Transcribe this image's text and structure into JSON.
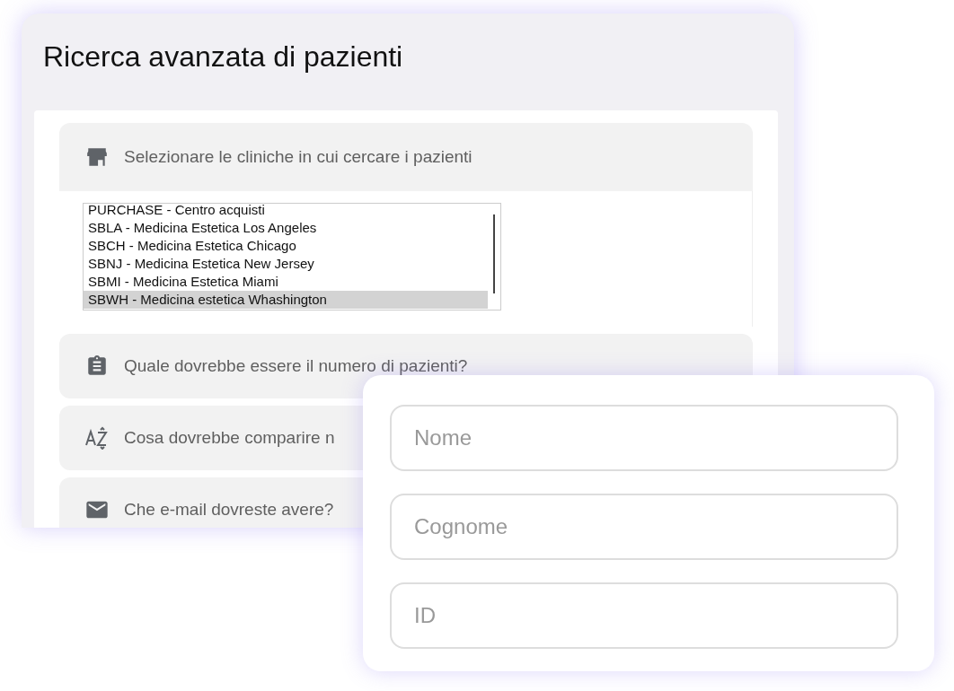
{
  "window": {
    "title": "Ricerca avanzata di pazienti"
  },
  "sections": [
    {
      "label": "Selezionare le cliniche in cui cercare i pazienti",
      "expanded": true,
      "clinics": [
        {
          "label": "PURCHASE - Centro acquisti",
          "selected": false
        },
        {
          "label": "SBLA - Medicina Estetica Los Angeles",
          "selected": false
        },
        {
          "label": "SBCH - Medicina Estetica Chicago",
          "selected": false
        },
        {
          "label": "SBNJ - Medicina Estetica New Jersey",
          "selected": false
        },
        {
          "label": "SBMI - Medicina Estetica Miami",
          "selected": false
        },
        {
          "label": "SBWH - Medicina estetica Whashington",
          "selected": true
        }
      ]
    },
    {
      "label": "Quale dovrebbe essere il numero di pazienti?",
      "expanded": false
    },
    {
      "label": "Cosa dovrebbe comparire n",
      "expanded": false
    },
    {
      "label": "Che e-mail dovreste avere?",
      "expanded": false
    }
  ],
  "name_fields": [
    {
      "placeholder": "Nome"
    },
    {
      "placeholder": "Cognome"
    },
    {
      "placeholder": "ID"
    }
  ]
}
